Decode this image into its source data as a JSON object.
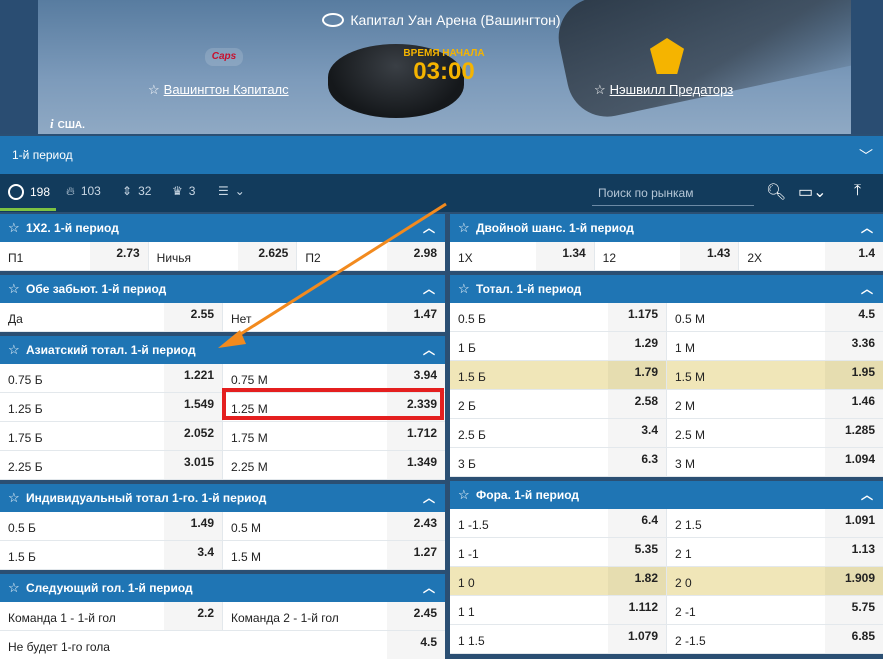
{
  "header": {
    "venue": "Капитал Уан Арена (Вашингтон)",
    "start_label": "ВРЕМЯ НАЧАЛА",
    "start_time": "03:00",
    "team1": "Вашингтон Кэпиталс",
    "team2": "Нэшвилл Предаторз",
    "country": "США."
  },
  "period": {
    "label": "1-й период"
  },
  "toolbar": {
    "all_count": "198",
    "hot_count": "103",
    "updown_count": "32",
    "cup_count": "3",
    "search_placeholder": "Поиск по рынкам"
  },
  "markets_left": [
    {
      "title": "1Х2. 1-й период",
      "rows": [
        {
          "cells": [
            {
              "n": "П1",
              "c": "2.73"
            },
            {
              "n": "Ничья",
              "c": "2.625"
            },
            {
              "n": "П2",
              "c": "2.98"
            }
          ]
        }
      ]
    },
    {
      "title": "Обе забьют. 1-й период",
      "rows": [
        {
          "cells": [
            {
              "n": "Да",
              "c": "2.55"
            },
            {
              "n": "Нет",
              "c": "1.47"
            }
          ]
        }
      ]
    },
    {
      "title": "Азиатский тотал. 1-й период",
      "rows": [
        {
          "cells": [
            {
              "n": "0.75 Б",
              "c": "1.221"
            },
            {
              "n": "0.75 М",
              "c": "3.94"
            }
          ]
        },
        {
          "cells": [
            {
              "n": "1.25 Б",
              "c": "1.549"
            },
            {
              "n": "1.25 М",
              "c": "2.339"
            }
          ]
        },
        {
          "cells": [
            {
              "n": "1.75 Б",
              "c": "2.052"
            },
            {
              "n": "1.75 М",
              "c": "1.712"
            }
          ]
        },
        {
          "cells": [
            {
              "n": "2.25 Б",
              "c": "3.015"
            },
            {
              "n": "2.25 М",
              "c": "1.349"
            }
          ]
        }
      ]
    },
    {
      "title": "Индивидуальный тотал 1-го. 1-й период",
      "rows": [
        {
          "cells": [
            {
              "n": "0.5 Б",
              "c": "1.49"
            },
            {
              "n": "0.5 М",
              "c": "2.43"
            }
          ]
        },
        {
          "cells": [
            {
              "n": "1.5 Б",
              "c": "3.4"
            },
            {
              "n": "1.5 М",
              "c": "1.27"
            }
          ]
        }
      ]
    },
    {
      "title": "Следующий гол. 1-й период",
      "rows": [
        {
          "cells": [
            {
              "n": "Команда 1 - 1-й гол",
              "c": "2.2"
            },
            {
              "n": "Команда 2 - 1-й гол",
              "c": "2.45"
            }
          ]
        },
        {
          "cells": [
            {
              "n": "Не будет 1-го гола",
              "c": "4.5"
            }
          ]
        }
      ]
    }
  ],
  "markets_right": [
    {
      "title": "Двойной шанс. 1-й период",
      "rows": [
        {
          "cells": [
            {
              "n": "1Х",
              "c": "1.34"
            },
            {
              "n": "12",
              "c": "1.43"
            },
            {
              "n": "2Х",
              "c": "1.4"
            }
          ]
        }
      ]
    },
    {
      "title": "Тотал. 1-й период",
      "rows": [
        {
          "cells": [
            {
              "n": "0.5 Б",
              "c": "1.175"
            },
            {
              "n": "0.5 М",
              "c": "4.5"
            }
          ]
        },
        {
          "cells": [
            {
              "n": "1 Б",
              "c": "1.29"
            },
            {
              "n": "1 М",
              "c": "3.36"
            }
          ]
        },
        {
          "hl": true,
          "cells": [
            {
              "n": "1.5 Б",
              "c": "1.79"
            },
            {
              "n": "1.5 М",
              "c": "1.95"
            }
          ]
        },
        {
          "cells": [
            {
              "n": "2 Б",
              "c": "2.58"
            },
            {
              "n": "2 М",
              "c": "1.46"
            }
          ]
        },
        {
          "cells": [
            {
              "n": "2.5 Б",
              "c": "3.4"
            },
            {
              "n": "2.5 М",
              "c": "1.285"
            }
          ]
        },
        {
          "cells": [
            {
              "n": "3 Б",
              "c": "6.3"
            },
            {
              "n": "3 М",
              "c": "1.094"
            }
          ]
        }
      ]
    },
    {
      "title": "Фора. 1-й период",
      "rows": [
        {
          "cells": [
            {
              "n": "1 -1.5",
              "c": "6.4"
            },
            {
              "n": "2 1.5",
              "c": "1.091"
            }
          ]
        },
        {
          "cells": [
            {
              "n": "1 -1",
              "c": "5.35"
            },
            {
              "n": "2 1",
              "c": "1.13"
            }
          ]
        },
        {
          "hl": true,
          "cells": [
            {
              "n": "1 0",
              "c": "1.82"
            },
            {
              "n": "2 0",
              "c": "1.909"
            }
          ]
        },
        {
          "cells": [
            {
              "n": "1 1",
              "c": "1.112"
            },
            {
              "n": "2 -1",
              "c": "5.75"
            }
          ]
        },
        {
          "cells": [
            {
              "n": "1 1.5",
              "c": "1.079"
            },
            {
              "n": "2 -1.5",
              "c": "6.85"
            }
          ]
        }
      ]
    }
  ],
  "colors": {
    "accent": "#1f75b4",
    "toolbar": "#123b5c",
    "highlight_row": "#f0e6b8",
    "annotation_box": "#e41f1f",
    "annotation_arrow": "#f28a1e",
    "active_filter": "#7dc242"
  }
}
